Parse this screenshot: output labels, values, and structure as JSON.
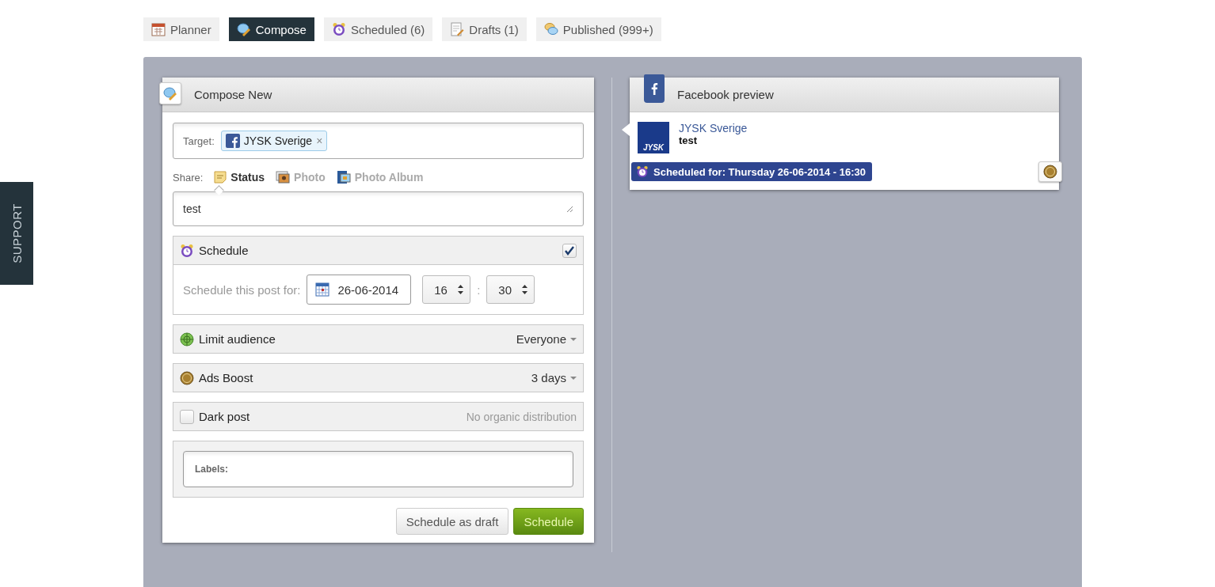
{
  "support_tab": {
    "label": "SUPPORT"
  },
  "tabs": [
    {
      "label": "Planner",
      "kind": "planner",
      "selected": false
    },
    {
      "label": "Compose",
      "kind": "compose",
      "selected": true
    },
    {
      "label": "Scheduled (6)",
      "kind": "clock",
      "selected": false
    },
    {
      "label": "Drafts (1)",
      "kind": "draft",
      "selected": false
    },
    {
      "label": "Published (999+)",
      "kind": "bubbles",
      "selected": false
    }
  ],
  "compose": {
    "title": "Compose New",
    "target": {
      "label": "Target:",
      "chip": "JYSK Sverige",
      "remove": "×"
    },
    "share": {
      "label": "Share:",
      "options": [
        {
          "label": "Status",
          "kind": "status",
          "selected": true
        },
        {
          "label": "Photo",
          "kind": "photo",
          "selected": false
        },
        {
          "label": "Photo Album",
          "kind": "album",
          "selected": false
        }
      ]
    },
    "message": "test",
    "schedule": {
      "title": "Schedule",
      "checked": true,
      "label": "Schedule this post for:",
      "date": "26-06-2014",
      "hour": "16",
      "separator": ":",
      "minute": "30"
    },
    "options": [
      {
        "kind": "audience",
        "label": "Limit audience",
        "value": "Everyone"
      },
      {
        "kind": "boost",
        "label": "Ads Boost",
        "value": "3 days"
      },
      {
        "kind": "checkbox",
        "label": "Dark post",
        "checked": false,
        "note": "No organic distribution"
      }
    ],
    "labels": {
      "label": "Labels:"
    },
    "buttons": [
      {
        "label": "Schedule as draft",
        "kind": "secondary"
      },
      {
        "label": "Schedule",
        "kind": "primary"
      }
    ]
  },
  "preview": {
    "title": "Facebook preview",
    "avatar_text": "JYSK",
    "page_name": "JYSK Sverige",
    "message": "test",
    "scheduled": "Scheduled for: Thursday 26-06-2014 - 16:30"
  }
}
